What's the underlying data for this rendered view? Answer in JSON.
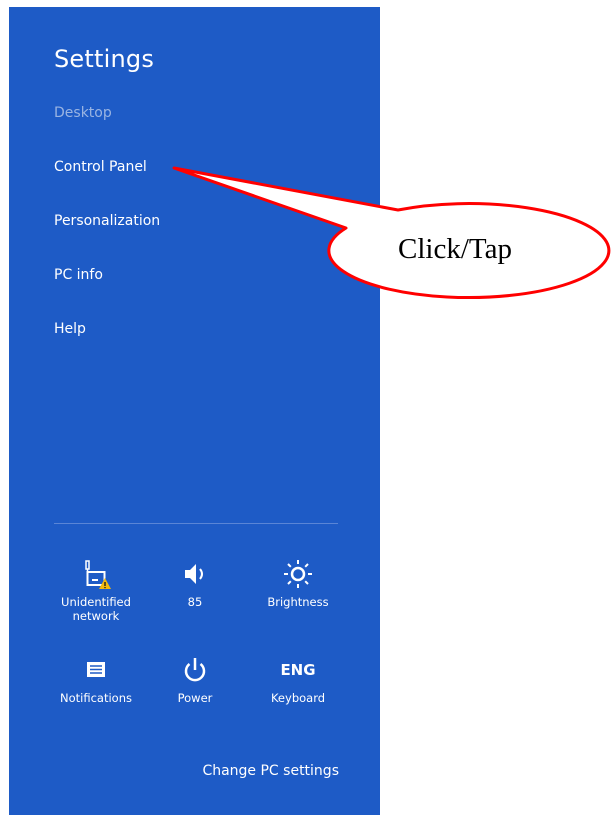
{
  "panel": {
    "title": "Settings",
    "items": [
      {
        "label": "Desktop",
        "enabled": false
      },
      {
        "label": "Control Panel",
        "enabled": true
      },
      {
        "label": "Personalization",
        "enabled": true
      },
      {
        "label": "PC info",
        "enabled": true
      },
      {
        "label": "Help",
        "enabled": true
      }
    ],
    "background_color": "#1e5bc6"
  },
  "quick_settings": [
    {
      "label": "Unidentified network",
      "icon": "network-warning-icon"
    },
    {
      "label": "85",
      "icon": "volume-icon"
    },
    {
      "label": "Brightness",
      "icon": "brightness-icon"
    },
    {
      "label": "Notifications",
      "icon": "notifications-icon"
    },
    {
      "label": "Power",
      "icon": "power-icon"
    },
    {
      "label": "Keyboard",
      "icon": "keyboard-icon",
      "icon_text": "ENG"
    }
  ],
  "footer": {
    "change_pc_settings": "Change PC settings"
  },
  "annotation": {
    "callout_text": "Click/Tap",
    "callout_color": "#ff0000"
  }
}
